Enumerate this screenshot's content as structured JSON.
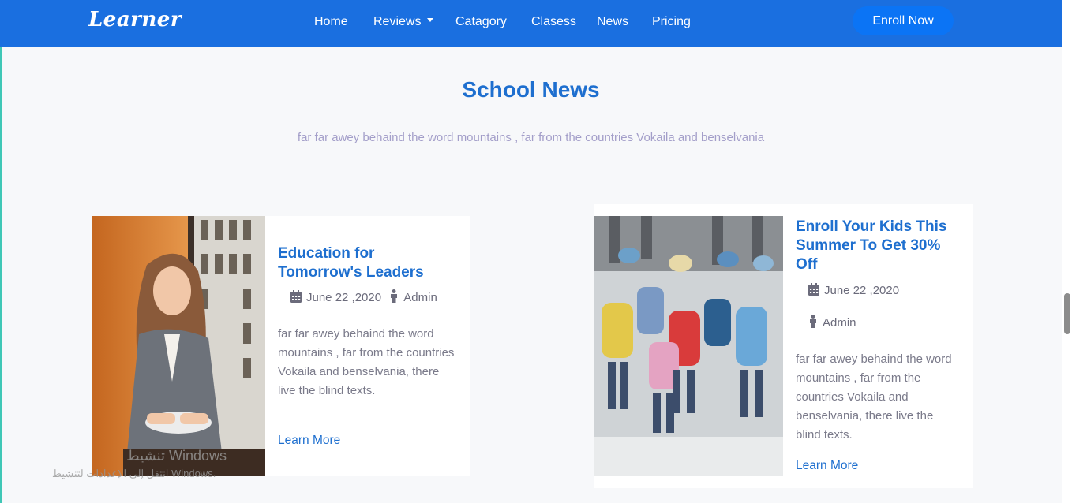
{
  "brand": "Learner",
  "nav": {
    "items": [
      "Home",
      "Reviews",
      "Catagory",
      "Clasess",
      "News",
      "Pricing"
    ],
    "enroll_label": "Enroll Now"
  },
  "section": {
    "title": "School News",
    "subtitle": "far far awey behaind the word mountains , far from the countries Vokaila and benselvania"
  },
  "cards": [
    {
      "title": "Education for Tomorrow's Leaders",
      "date": "June 22 ,2020",
      "author": "Admin",
      "text": "far far awey behaind the word mountains , far from the countries Vokaila and benselvania, there live the blind texts.",
      "link": "Learn More"
    },
    {
      "title": "Enroll Your Kids This Summer To Get 30% Off",
      "date": "June 22 ,2020",
      "author": "Admin",
      "text": "far far awey behaind the word mountains , far from the countries Vokaila and benselvania, there live the blind texts.",
      "link": "Learn More"
    }
  ],
  "watermark": {
    "line1": "تنشيط Windows",
    "line2": "انتقل إلى الإعدادات لتنشيط Windows."
  },
  "icons": {
    "calendar": "calendar-icon",
    "author": "person-icon",
    "caret": "chevron-down-icon"
  },
  "colors": {
    "navbar": "#1a6fe0",
    "button": "#0b74f5",
    "accent": "#1e6fcf",
    "subtitle": "#a39ec9"
  }
}
